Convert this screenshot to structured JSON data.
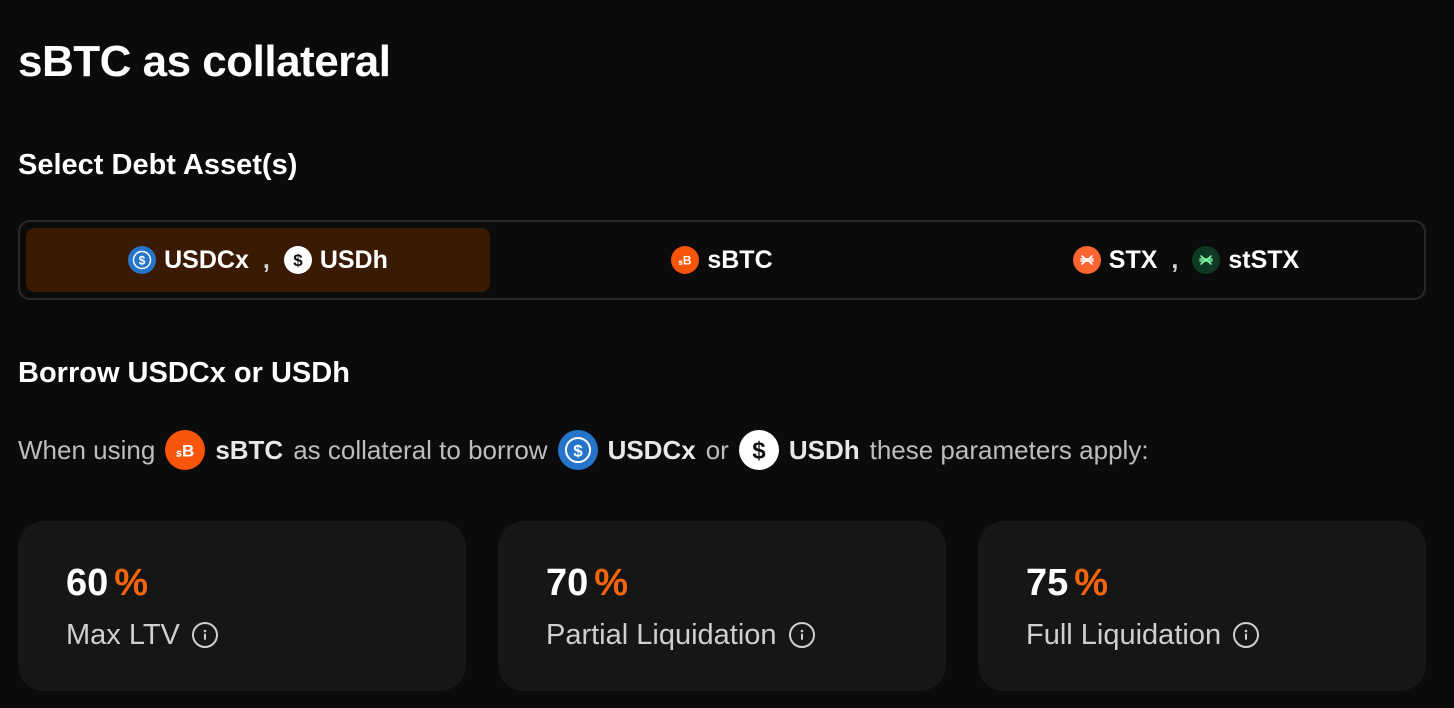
{
  "page_title": "sBTC as collateral",
  "select_section": {
    "title": "Select Debt Asset(s)",
    "options": [
      {
        "assets": [
          "USDCx",
          "USDh"
        ],
        "separator": ",",
        "active": true
      },
      {
        "assets": [
          "sBTC"
        ],
        "active": false
      },
      {
        "assets": [
          "STX",
          "stSTX"
        ],
        "separator": ",",
        "active": false
      }
    ]
  },
  "borrow_section": {
    "title": "Borrow USDCx or USDh",
    "desc_prefix": "When using",
    "collateral_asset": "sBTC",
    "desc_middle": "as collateral to borrow",
    "debt_asset_1": "USDCx",
    "desc_or": "or",
    "debt_asset_2": "USDh",
    "desc_suffix": "these parameters apply:"
  },
  "params": [
    {
      "value": "60",
      "unit": "%",
      "label": "Max LTV"
    },
    {
      "value": "70",
      "unit": "%",
      "label": "Partial Liquidation"
    },
    {
      "value": "75",
      "unit": "%",
      "label": "Full Liquidation"
    }
  ],
  "colors": {
    "accent": "#f7640c",
    "active_segment_bg": "#3b1a03",
    "usdc": "#2775ca",
    "sbtc": "#f7540c",
    "stx": "#fc6432",
    "ststx": "#0f3a22"
  },
  "icons": [
    "usdc-icon",
    "usdh-icon",
    "sbtc-icon",
    "stx-icon",
    "ststx-icon",
    "info-icon"
  ]
}
